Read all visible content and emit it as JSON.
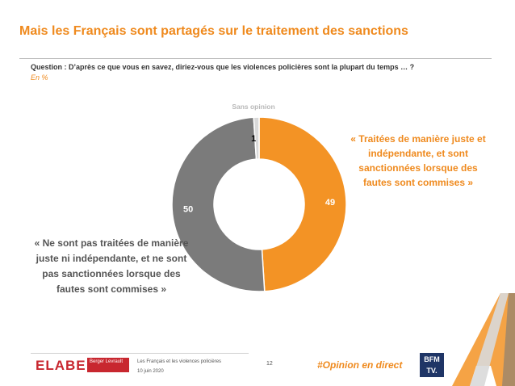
{
  "header": {
    "title": "Mais les Français sont partagés sur le traitement des sanctions",
    "question": "Question : D’après ce que vous en savez, diriez-vous que les violences policières sont la plupart du temps … ?",
    "unit": "En %"
  },
  "chart_data": {
    "type": "pie",
    "style": "donut",
    "categories": [
      "« Traitées de manière juste et indépendante, et sont sanctionnées lorsque des fautes sont commises »",
      "« Ne sont pas traitées de manière juste ni indépendante, et ne sont pas sanctionnées lorsque des fautes sont commises »",
      "Sans opinion"
    ],
    "values": [
      49,
      50,
      1
    ],
    "colors": [
      "#f39325",
      "#7b7b7b",
      "#d9d9d9"
    ],
    "value_label_colors": [
      "#ffffff",
      "#ffffff",
      "#000000"
    ]
  },
  "callouts": {
    "right": "« Traitées de manière juste et indépendante, et sont sanctionnées lorsque des fautes sont commises »",
    "left": "« Ne sont pas traitées de manière juste ni indépendante, et ne sont pas sanctionnées lorsque des fautes sont commises »",
    "top": "Sans opinion"
  },
  "footer": {
    "logo_elabe": "ELABE",
    "logo_berger": "Berger Levrault",
    "study": "Les Français et les violences policières",
    "date": "10 juin 2020",
    "page": "12",
    "hashtag": "#Opinion en direct",
    "logo_bfm": "BFM TV."
  },
  "colors": {
    "accent": "#ef8a1e",
    "grey_slice": "#7b7b7b",
    "brand_red": "#c8272f",
    "bfm_blue": "#1f3566"
  }
}
